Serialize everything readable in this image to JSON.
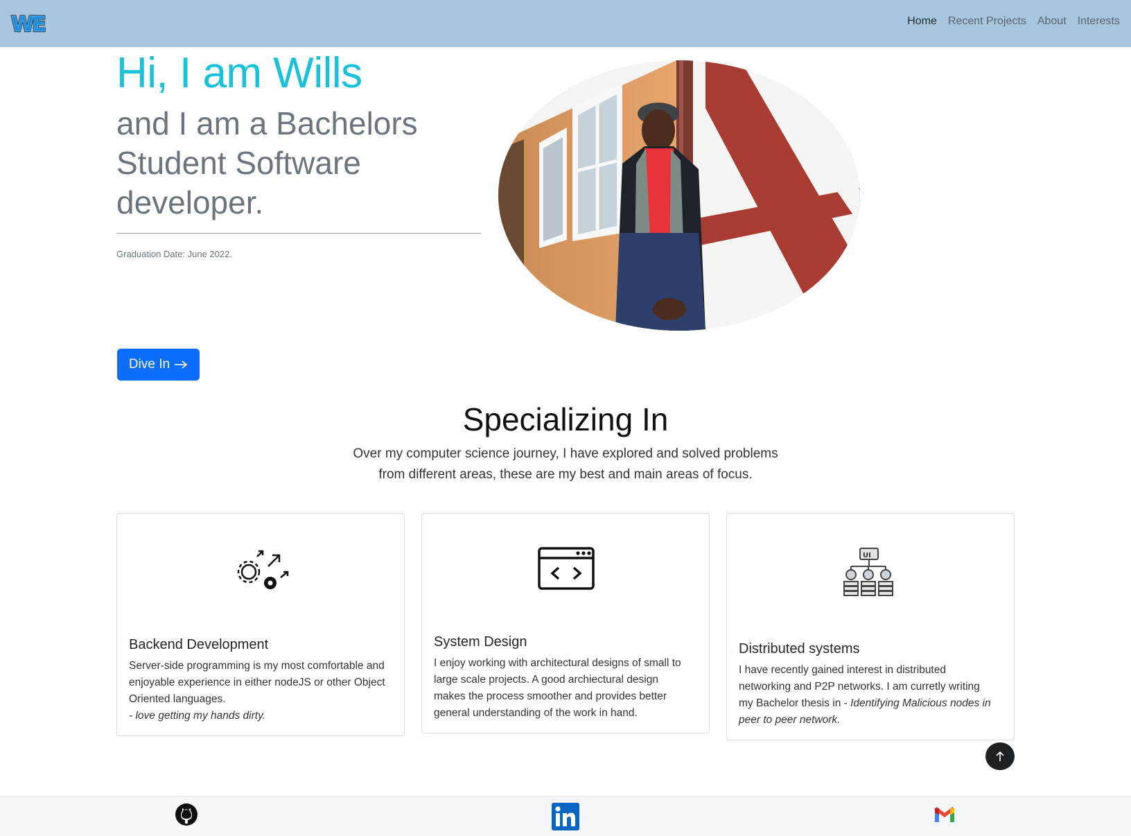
{
  "navbar": {
    "logo_text": "WE",
    "links": [
      {
        "label": "Home",
        "active": true
      },
      {
        "label": "Recent Projects",
        "active": false
      },
      {
        "label": "About",
        "active": false
      },
      {
        "label": "Interests",
        "active": false
      }
    ]
  },
  "hero": {
    "greeting": "Hi, I am Wills",
    "subtitle": "and I am a Bachelors Student Software developer.",
    "graduation": "Graduation Date: June 2022.",
    "cta_label": "Dive In",
    "cta_icon": "arrow-right-icon"
  },
  "specializing": {
    "title": "Specializing In",
    "description_line1": "Over my computer science journey, I have explored and solved problems",
    "description_line2": "from different areas, these are my best and main areas of focus."
  },
  "cards": [
    {
      "icon": "gears-arrows-icon",
      "title": "Backend Development",
      "text": "Server-side programming is my most comfortable and enjoyable experience in either nodeJS or other Object Oriented languages.",
      "italic": "- love getting my hands dirty."
    },
    {
      "icon": "code-window-icon",
      "title": "System Design",
      "text": "I enjoy working with architectural designs of small to large scale projects. A good archiectural design makes the process smoother and provides better general understanding of the work in hand."
    },
    {
      "icon": "ui-network-icon",
      "title": "Distributed systems",
      "text": "I have recently gained interest in distributed networking and P2P networks. I am curretly writing my Bachelor thesis in - ",
      "italic": "Identifying Malicious nodes in peer to peer network."
    }
  ],
  "footer": {
    "links": [
      {
        "icon": "github-icon"
      },
      {
        "icon": "linkedin-icon"
      },
      {
        "icon": "gmail-icon"
      }
    ]
  },
  "colors": {
    "navbar_bg": "#a7c5dc",
    "greeting": "#17c2dd",
    "cta_bg": "#0d6efd",
    "linkedin": "#0a66c2"
  }
}
